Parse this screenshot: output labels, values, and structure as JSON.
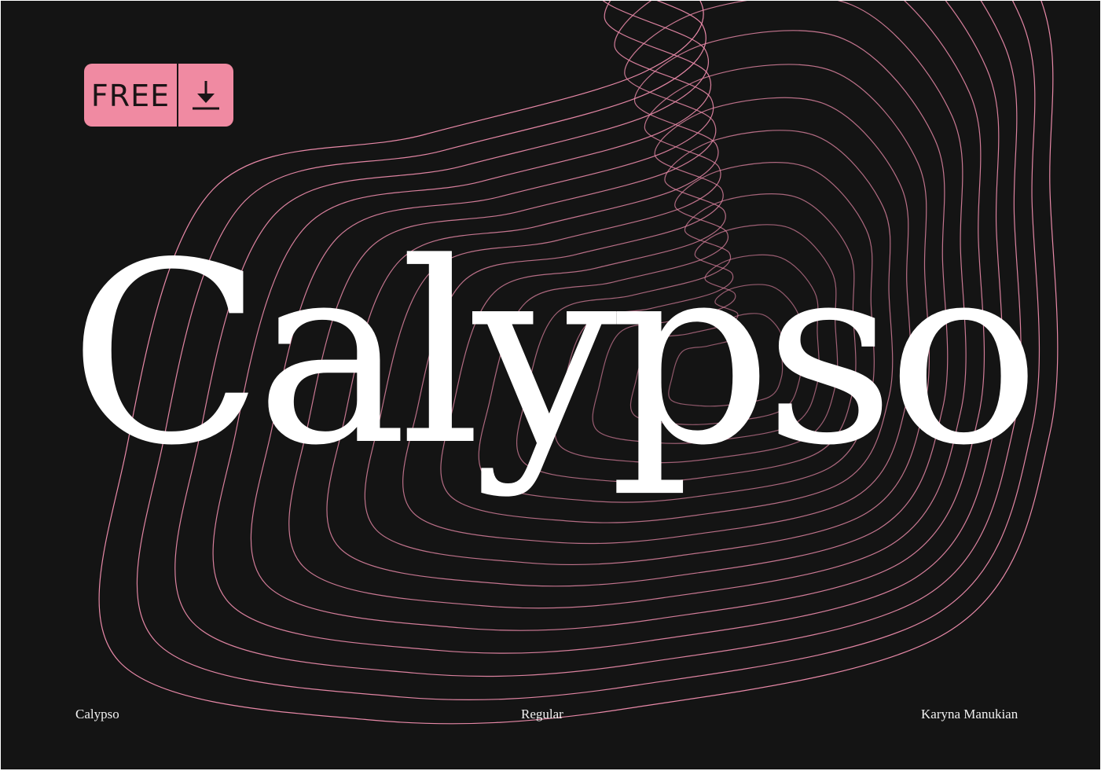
{
  "badge": {
    "label": "FREE",
    "icon": "download-icon",
    "background": "#f08aa2"
  },
  "title": "Calypso",
  "footer": {
    "font_name": "Calypso",
    "style": "Regular",
    "author": "Karyna Manukian"
  },
  "colors": {
    "background": "#141414",
    "contour_lines": "#e889a8",
    "title": "#ffffff"
  }
}
